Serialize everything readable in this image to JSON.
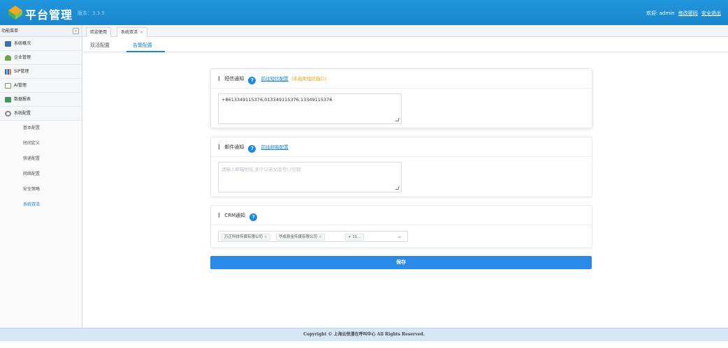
{
  "header": {
    "title": "平台管理",
    "version": "版本：3.3.5",
    "welcome": "欢迎: admin",
    "change_password": "修改密码",
    "logout": "安全退出"
  },
  "sidebar": {
    "title": "功能菜单",
    "items": [
      {
        "label": "系统概况",
        "icon": "monitor-icon",
        "color": "#3b6fb6"
      },
      {
        "label": "企业管理",
        "icon": "user-icon",
        "color": "#6aa84f"
      },
      {
        "label": "SIP管理",
        "icon": "bar-chart-icon",
        "color": "#2d6fb7"
      },
      {
        "label": "AI管理",
        "icon": "ai-icon",
        "color": "#7a9a5a"
      },
      {
        "label": "数据报表",
        "icon": "report-icon",
        "color": "#3d9a5c"
      },
      {
        "label": "系统配置",
        "icon": "gear-icon",
        "color": "#888888"
      }
    ],
    "sub_items": [
      "基本配置",
      "时间定义",
      "快递配置",
      "网络配置",
      "安全策略",
      "系统双活"
    ]
  },
  "tabs": [
    "欢迎使用",
    "系统双活"
  ],
  "subtabs": [
    "双活配置",
    "告警配置"
  ],
  "sms": {
    "title": "短信通知",
    "link": "前往短信配置",
    "warn": "(未启用短信猫口)",
    "value": "+8613349115376,013349115376,13349115376"
  },
  "email": {
    "title": "邮件通知",
    "link": "前往邮箱配置",
    "placeholder": "请输入邮箱地址,多个以英文逗号(,)分割"
  },
  "crm": {
    "title": "CRM通知",
    "tags": [
      "万正科技传媒有限公司",
      "华成县金传媒有限公司"
    ],
    "more": "+ 11..."
  },
  "save_label": "保存",
  "footer": "Copyright © 上海云悦漫在呼叫中心 All Rights Reserved.",
  "colors": {
    "primary": "#1a86cc",
    "button": "#2a8ae6",
    "warn": "#f39c12"
  }
}
